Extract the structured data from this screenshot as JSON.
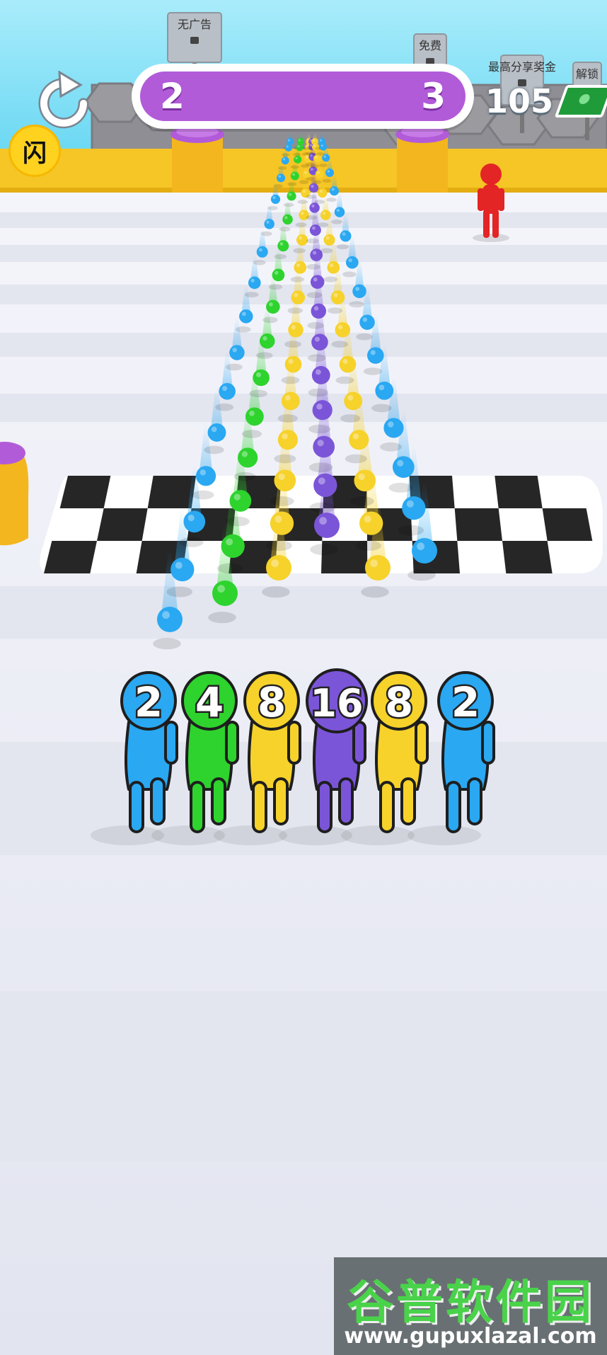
{
  "hud": {
    "level_current": "2",
    "level_next": "3",
    "cash_amount": "105",
    "restart_icon": "restart-arrow-icon",
    "flash_label": "闪",
    "cash_icon": "banknote-icon"
  },
  "signs": [
    "无广告",
    "免费",
    "最高分享奖金",
    "解锁"
  ],
  "runners": [
    {
      "value": "2",
      "color": "#2aa8f2"
    },
    {
      "value": "4",
      "color": "#2ed32e"
    },
    {
      "value": "8",
      "color": "#f6d22b"
    },
    {
      "value": "16",
      "color": "#7b55d8"
    },
    {
      "value": "8",
      "color": "#f6d22b"
    },
    {
      "value": "2",
      "color": "#2aa8f2"
    }
  ],
  "colors": {
    "water": "#7fdff4",
    "track": "#eef0f8",
    "border": "#f6c526",
    "enemy": "#e32525"
  },
  "watermark": {
    "title": "谷普软件园",
    "url": "www.gupuxlazal.com"
  }
}
